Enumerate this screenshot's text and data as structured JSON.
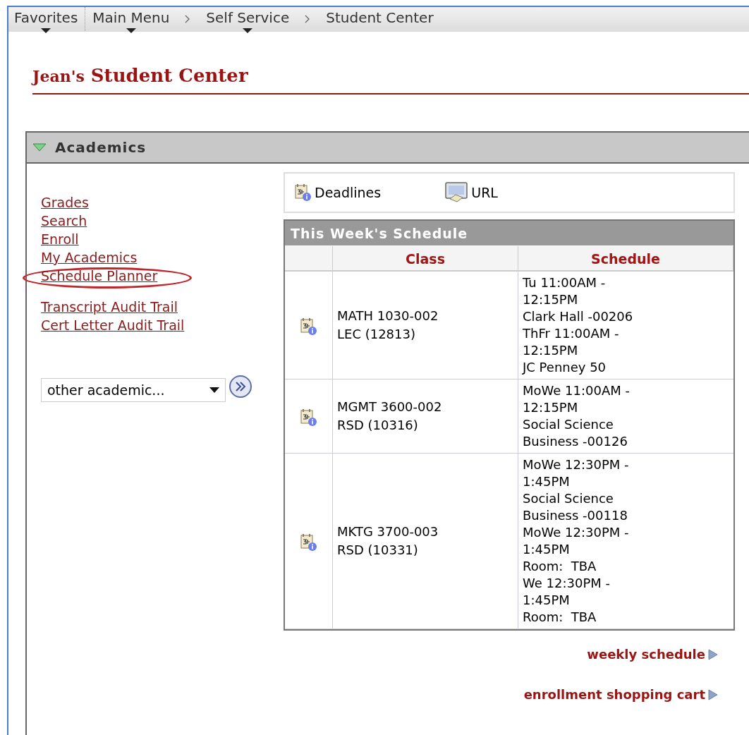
{
  "breadcrumb": [
    {
      "label": "Favorites",
      "dropdown": true
    },
    {
      "label": "Main Menu",
      "dropdown": true
    },
    {
      "label": "Self Service",
      "dropdown": true
    },
    {
      "label": "Student Center",
      "dropdown": false
    }
  ],
  "page_title": {
    "owner": "Jean's",
    "title": "Student Center"
  },
  "academics": {
    "title": "Academics",
    "expanded": true,
    "links": [
      {
        "label": "Grades",
        "circled": false
      },
      {
        "label": "Search",
        "circled": false
      },
      {
        "label": "Enroll",
        "circled": false
      },
      {
        "label": "My Academics",
        "circled": false
      },
      {
        "label": "Schedule Planner",
        "circled": true
      },
      {
        "label": "Transcript Audit Trail",
        "circled": false
      },
      {
        "label": "Cert Letter Audit Trail",
        "circled": false
      }
    ],
    "other_select": {
      "value": "other academic..."
    },
    "quick_links": [
      {
        "kind": "deadlines",
        "label": "Deadlines"
      },
      {
        "kind": "url",
        "label": "URL"
      }
    ],
    "schedule": {
      "title": "This Week's Schedule",
      "columns": [
        "Class",
        "Schedule"
      ],
      "rows": [
        {
          "class": [
            "MATH 1030-002",
            "LEC (12813)"
          ],
          "schedule": [
            "Tu 11:00AM -",
            "12:15PM",
            "Clark Hall -00206",
            "ThFr 11:00AM -",
            "12:15PM",
            "JC Penney 50"
          ]
        },
        {
          "class": [
            "MGMT 3600-002",
            "RSD (10316)"
          ],
          "schedule": [
            "MoWe 11:00AM -",
            "12:15PM",
            "Social Science",
            "Business -00126"
          ]
        },
        {
          "class": [
            "MKTG 3700-003",
            "RSD (10331)"
          ],
          "schedule": [
            "MoWe 12:30PM -",
            "1:45PM",
            "Social Science",
            "Business -00118",
            "MoWe 12:30PM -",
            "1:45PM",
            "Room:  TBA",
            "We 12:30PM -",
            "1:45PM",
            "Room:  TBA"
          ]
        }
      ]
    },
    "footer_links": [
      "weekly schedule",
      "enrollment shopping cart"
    ]
  }
}
